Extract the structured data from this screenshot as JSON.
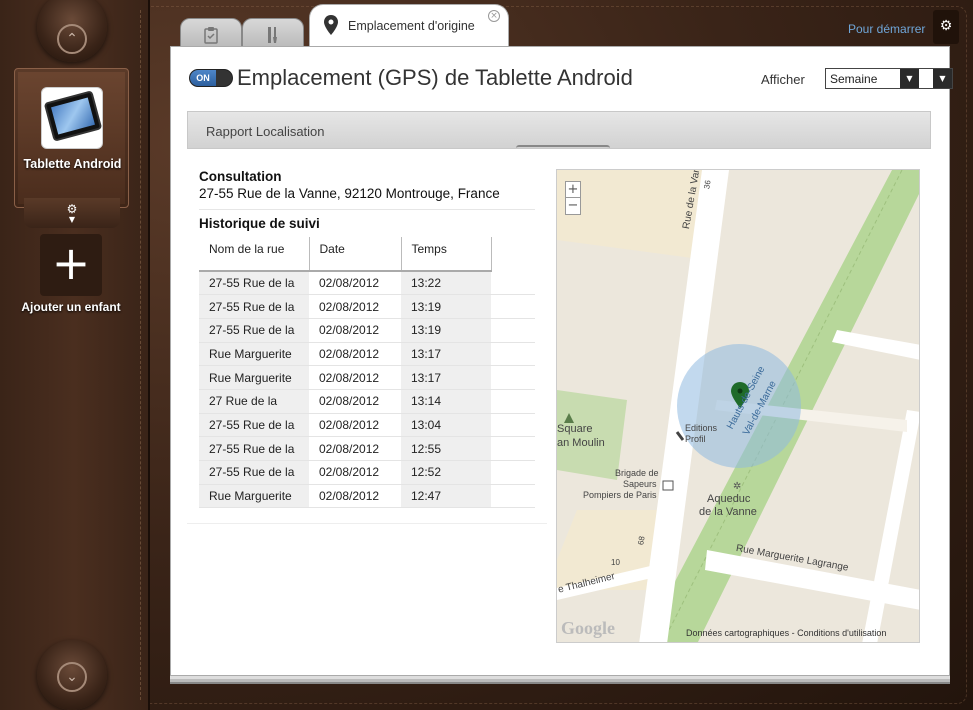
{
  "sidebar": {
    "nav_up_glyph": "⌃",
    "nav_down_glyph": "⌄",
    "device_name": "Tablette Android",
    "settings_glyph": "⚙",
    "add_glyph": "+",
    "add_child_label": "Ajouter un enfant"
  },
  "topbar": {
    "help_link": "Pour démarrer",
    "settings_glyph": "⚙"
  },
  "tabs": {
    "tab1_icon": "clipboard-icon",
    "tab2_icon": "tools-icon",
    "active_label": "Emplacement d'origine",
    "close_glyph": "×"
  },
  "header": {
    "toggle_label": "ON",
    "title": "Emplacement (GPS) de Tablette Android",
    "filter_label": "Afficher",
    "filter_value": "Semaine"
  },
  "report": {
    "bar_label": "Rapport Localisation",
    "consult_title": "Consultation",
    "consult_address": "27-55 Rue de la Vanne, 92120 Montrouge, France",
    "history_title": "Historique de suivi",
    "columns": [
      "Nom de la rue",
      "Date",
      "Temps"
    ],
    "rows": [
      [
        "27-55 Rue de la",
        "02/08/2012",
        "13:22"
      ],
      [
        "27-55 Rue de la",
        "02/08/2012",
        "13:19"
      ],
      [
        "27-55 Rue de la",
        "02/08/2012",
        "13:19"
      ],
      [
        "Rue Marguerite",
        "02/08/2012",
        "13:17"
      ],
      [
        "Rue Marguerite",
        "02/08/2012",
        "13:17"
      ],
      [
        "27 Rue de la",
        "02/08/2012",
        "13:14"
      ],
      [
        "27-55 Rue de la",
        "02/08/2012",
        "13:04"
      ],
      [
        "27-55 Rue de la",
        "02/08/2012",
        "12:55"
      ],
      [
        "27-55 Rue de la",
        "02/08/2012",
        "12:52"
      ],
      [
        "Rue Marguerite",
        "02/08/2012",
        "12:47"
      ]
    ]
  },
  "map": {
    "zoom_in": "+",
    "zoom_out": "−",
    "labels": {
      "rue_vanne": "Rue de la Vanne",
      "num36": "36",
      "hauts_seine": "Hauts-de-Seine",
      "val_marne": "Val-de-Marne",
      "square": "Square",
      "moulin": "an Moulin",
      "editions": "Editions",
      "profil": "Profil",
      "brigade1": "Brigade de",
      "brigade2": "Sapeurs",
      "brigade3": "Pompiers de Paris",
      "aqueduc1": "Aqueduc",
      "aqueduc2": "de la Vanne",
      "marguerite": "Rue Marguerite Lagrange",
      "thalheimer": "e Thalheimer",
      "num10": "10",
      "num68": "68"
    },
    "logo": "Google",
    "attribution": "Données cartographiques - Conditions d'utilisation",
    "colors": {
      "park": "#c8dcb0",
      "rail": "#b7d79a",
      "accuracy_circle": "#8fb9e0",
      "pin": "#1f6b2a"
    }
  }
}
